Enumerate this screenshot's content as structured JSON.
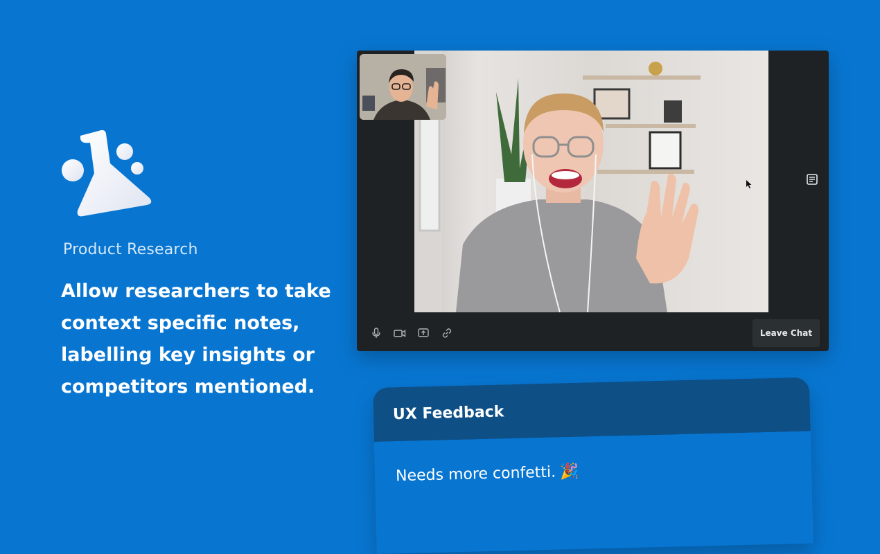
{
  "brand": {
    "icon": "flask-icon",
    "category": "Product Research",
    "headline_lines": [
      "Allow researchers to take",
      "context specific notes,",
      "labelling key insights or",
      "competitors mentioned."
    ]
  },
  "video_call": {
    "controls": [
      {
        "icon": "microphone-icon"
      },
      {
        "icon": "camera-icon"
      },
      {
        "icon": "share-screen-icon"
      },
      {
        "icon": "link-icon"
      }
    ],
    "leave_label": "Leave Chat",
    "notes_icon": "notes-icon"
  },
  "note_card": {
    "title": "UX Feedback",
    "body": "Needs more confetti.",
    "emoji": "🎉"
  },
  "colors": {
    "background": "#0876D1",
    "card_header": "#0E4F86",
    "call_window": "#1e2224"
  }
}
